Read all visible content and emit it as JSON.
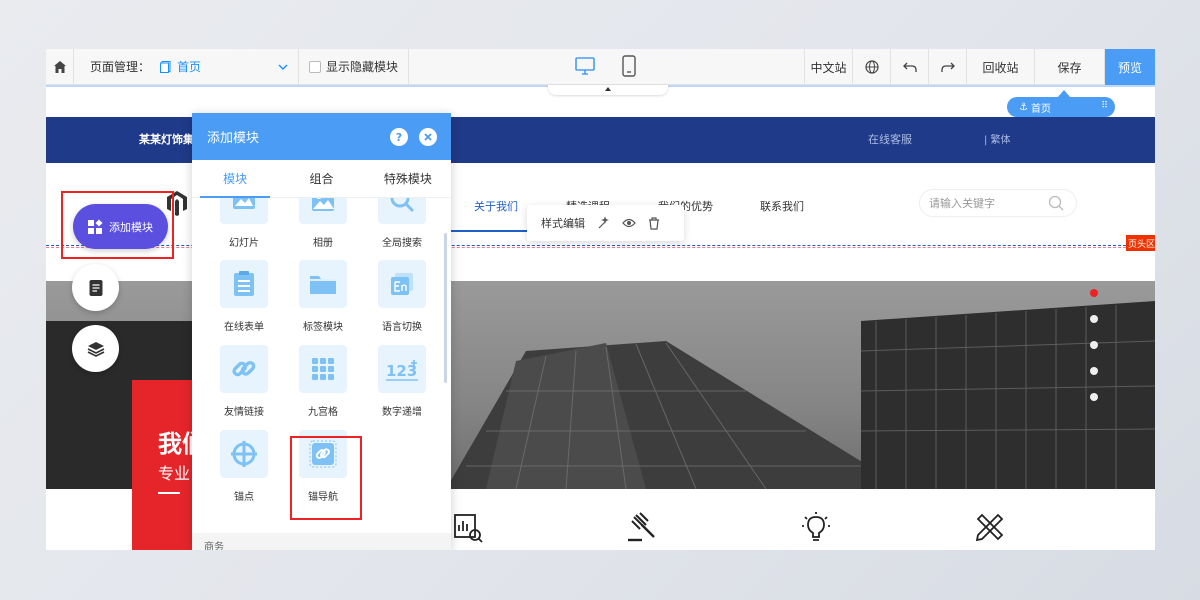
{
  "toolbar": {
    "page_manage_label": "页面管理：",
    "current_page": "首页",
    "show_hidden_label": "显示隐藏模块",
    "lang_site": "中文站",
    "recycle": "回收站",
    "save": "保存",
    "preview": "预览"
  },
  "anchor_pill": {
    "label": "首页"
  },
  "site": {
    "brand": "某某灯饰集",
    "service": "在线客服",
    "traditional": "| 繁体",
    "nav": [
      "关于我们",
      "精选课程",
      "我们的优势",
      "联系我们"
    ],
    "search_placeholder": "请输入关键字",
    "header_tag": "页头区",
    "banner_title": "我们",
    "banner_subtitle": "专业"
  },
  "style_popover": {
    "label": "样式编辑"
  },
  "floating": {
    "add_module": "添加模块"
  },
  "panel": {
    "title": "添加模块",
    "help": "?",
    "tabs": [
      "模块",
      "组合",
      "特殊模块"
    ],
    "modules": [
      {
        "label": "幻灯片",
        "icon": "slideshow-icon"
      },
      {
        "label": "相册",
        "icon": "album-icon"
      },
      {
        "label": "全局搜索",
        "icon": "search-icon"
      },
      {
        "label": "在线表单",
        "icon": "form-icon"
      },
      {
        "label": "标签模块",
        "icon": "folder-icon"
      },
      {
        "label": "语言切换",
        "icon": "language-icon"
      },
      {
        "label": "友情链接",
        "icon": "link-icon"
      },
      {
        "label": "九宫格",
        "icon": "grid-icon"
      },
      {
        "label": "数字递增",
        "icon": "number-icon"
      },
      {
        "label": "锚点",
        "icon": "anchor-icon"
      },
      {
        "label": "锚导航",
        "icon": "anchor-nav-icon"
      }
    ],
    "footer": "商务"
  },
  "colors": {
    "accent": "#4a9cf5",
    "site_blue": "#1f3a88",
    "add_button": "#5b4fe0",
    "highlight_red": "#e22222"
  }
}
